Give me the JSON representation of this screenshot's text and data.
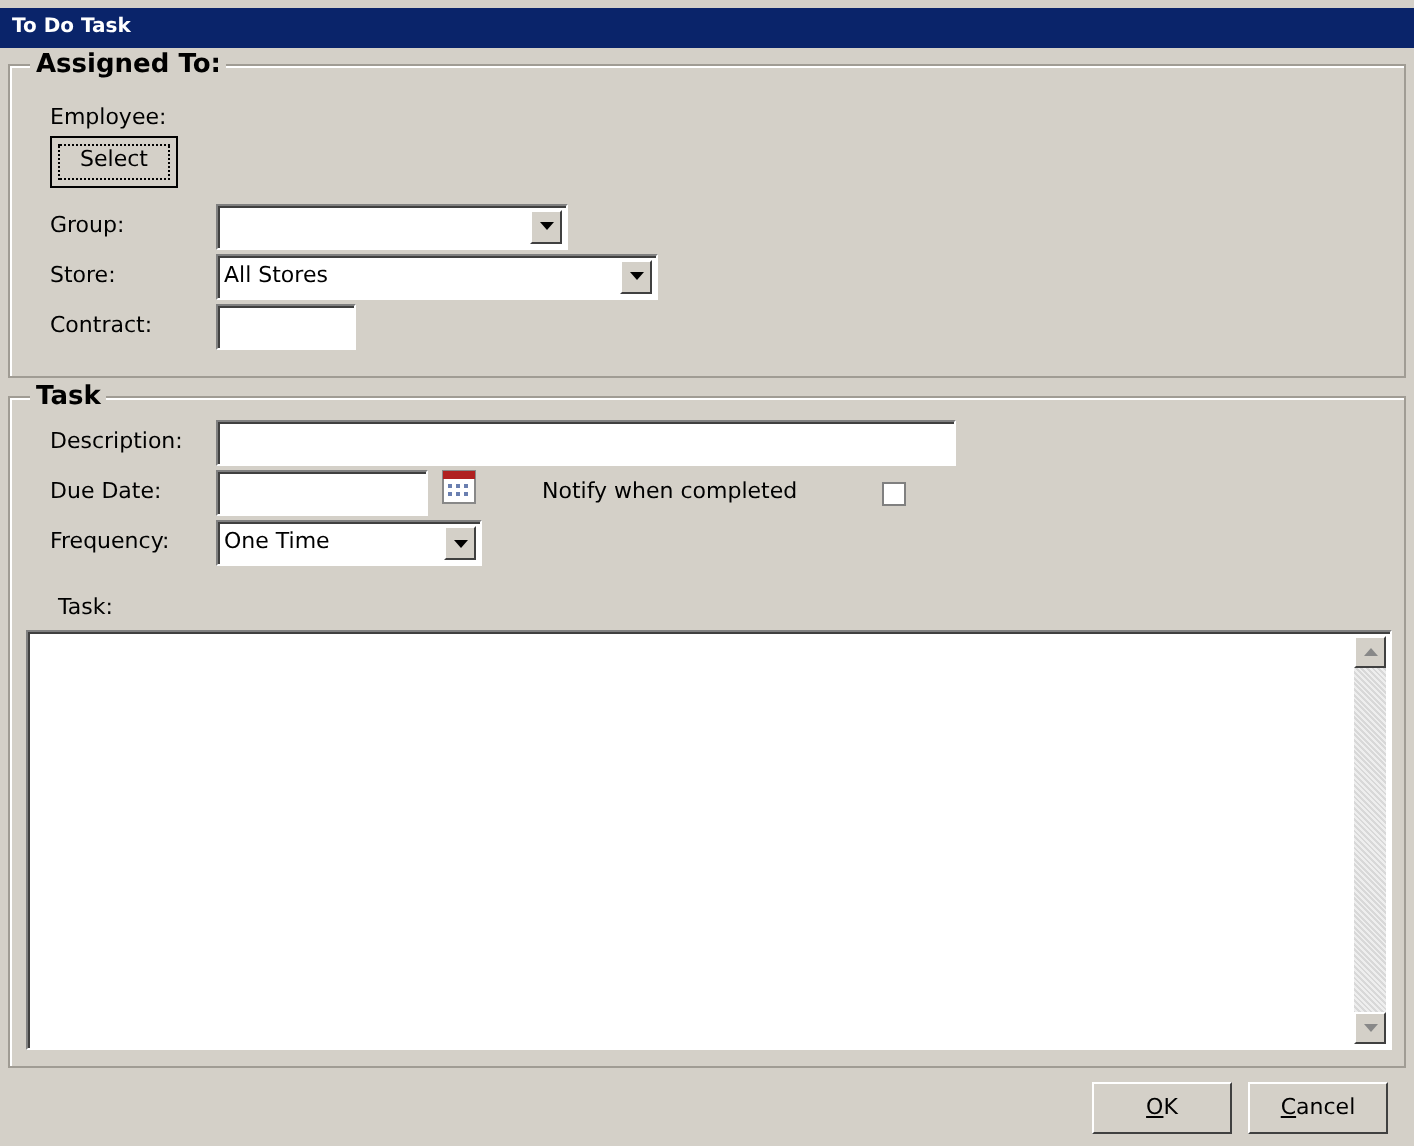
{
  "window": {
    "title": "To Do Task"
  },
  "assigned_to": {
    "title": "Assigned To:",
    "employee_label": "Employee:",
    "select_button": "Select",
    "group": {
      "label": "Group:"
    },
    "store": {
      "label": "Store:",
      "value": "All Stores"
    },
    "contract": {
      "label": "Contract:"
    }
  },
  "task": {
    "title": "Task",
    "description": {
      "label": "Description:"
    },
    "due_date": {
      "label": "Due Date:"
    },
    "notify": {
      "label": "Notify when completed",
      "checked": false
    },
    "frequency": {
      "label": "Frequency:",
      "value": "One Time"
    },
    "task_label": "Task:"
  },
  "buttons": [
    {
      "label": "OK"
    },
    {
      "label": "Cancel"
    }
  ]
}
